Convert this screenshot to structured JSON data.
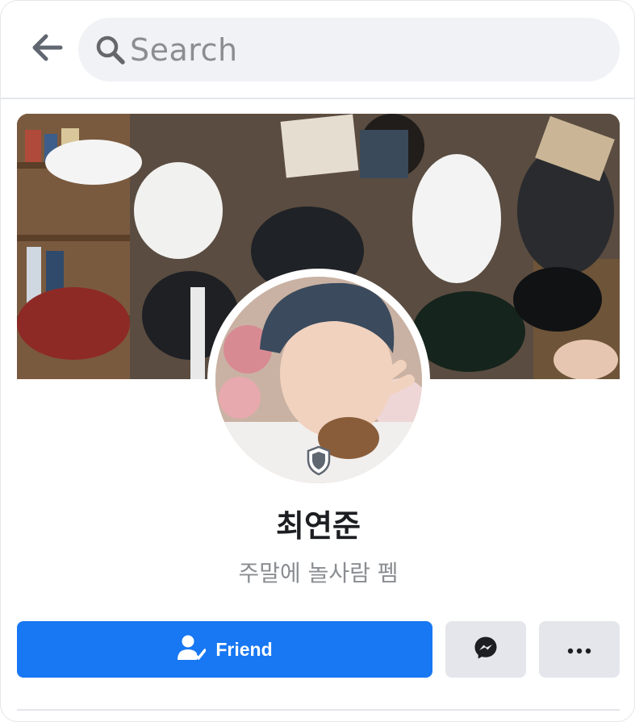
{
  "header": {
    "back_icon": "arrow-left-icon",
    "search_icon": "search-icon",
    "search_placeholder": "Search"
  },
  "profile": {
    "name": "최연준",
    "bio": "주말에 놀사람 펨",
    "cover_photo": "group-reading-photo",
    "avatar": "profile-photo",
    "badge_icon": "shield-icon"
  },
  "actions": {
    "friend_label": "Friend",
    "friend_icon": "person-check-icon",
    "message_icon": "messenger-icon",
    "more_icon": "more-dots-icon"
  },
  "colors": {
    "primary": "#1877f2",
    "secondary_button": "#e4e6eb",
    "search_bg": "#f0f2f5",
    "muted_text": "#8a8d91",
    "name_text": "#1c1e21"
  }
}
